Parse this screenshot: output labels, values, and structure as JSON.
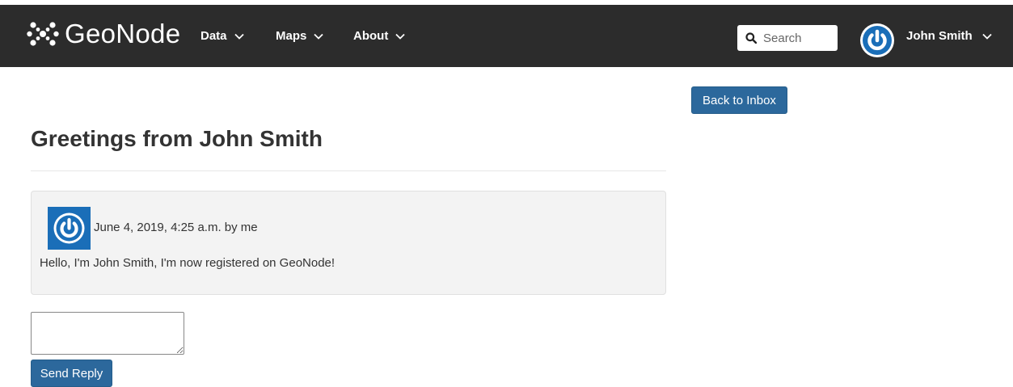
{
  "brand": {
    "name": "GeoNode"
  },
  "nav": {
    "items": [
      {
        "label": "Data"
      },
      {
        "label": "Maps"
      },
      {
        "label": "About"
      }
    ],
    "search": {
      "placeholder": "Search",
      "value": ""
    },
    "user": {
      "name": "John Smith"
    }
  },
  "actions": {
    "back_label": "Back to Inbox",
    "send_label": "Send Reply"
  },
  "thread": {
    "title": "Greetings from John Smith",
    "messages": [
      {
        "meta": "June 4, 2019, 4:25 a.m. by me",
        "body": "Hello, I'm John Smith, I'm now registered on GeoNode!"
      }
    ]
  },
  "reply": {
    "value": ""
  },
  "colors": {
    "navbar": "#2c2c2c",
    "primary_button": "#2c689c",
    "avatar": "#1a6eb8"
  }
}
